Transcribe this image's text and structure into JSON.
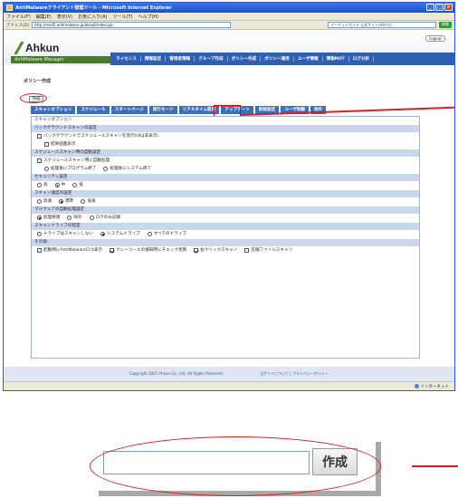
{
  "window": {
    "title": "AntiMalwareクライアント管理ツール - Microsoft Internet Explorer",
    "controls": [
      "_",
      "□",
      "×"
    ]
  },
  "menu": [
    "ファイル(F)",
    "編集(E)",
    "表示(V)",
    "お気に入り(A)",
    "ツール(T)",
    "ヘルプ(H)"
  ],
  "address": {
    "label": "アドレス(D)",
    "url": "http://mail5.antimalware.jp/aksx6/index.jsp",
    "search_text": "マーケットガイド 公式サイト(Alt+n)",
    "go_label": "移動"
  },
  "header": {
    "logout": "Logout",
    "logo_text": "Ahkun",
    "logo_sub": "AntiMalware Manager",
    "nav": [
      "ライセンス",
      "情報設定",
      "管理者情報",
      "グループ作成",
      "ポリシー作成",
      "ポリシー適用",
      "ユーザ情報",
      "情報NOT",
      "ログ分析"
    ]
  },
  "page": {
    "title": "ポリシー作成",
    "create_button": "作成"
  },
  "tabs": [
    "スキャンオプション",
    "スケジュール",
    "スタートページ",
    "実行モード",
    "リアルタイム監視",
    "アップデート",
    "削除設定",
    "ユーザ制御",
    "除外"
  ],
  "options": {
    "subtitle": "スキャンオプション",
    "sections": [
      {
        "header": "バックグラウンドスキャンの設定",
        "rows": [
          {
            "type": "checkbox",
            "checked": false,
            "label": "バックグラウンドでスケジュールスキャンを実行(UIは非表示)"
          },
          {
            "type": "checkbox",
            "checked": false,
            "label": "結果画面表示",
            "indent": true
          }
        ]
      },
      {
        "header": "スケジュールスキャン時の自動設定",
        "rows": [
          {
            "type": "checkbox",
            "checked": false,
            "label": "スケジュールスキャン時に自動処理"
          },
          {
            "type": "radios",
            "indent": true,
            "options": [
              {
                "label": "処理後にプログラム終了",
                "on": false
              },
              {
                "label": "処理後にシステム終了",
                "on": false
              }
            ]
          }
        ]
      },
      {
        "header": "セキュリティ設定",
        "rows": [
          {
            "type": "radios",
            "options": [
              {
                "label": "高",
                "on": false
              },
              {
                "label": "中",
                "on": true
              },
              {
                "label": "低",
                "on": false
              }
            ]
          }
        ]
      },
      {
        "header": "スキャン速度の設定",
        "rows": [
          {
            "type": "radios",
            "options": [
              {
                "label": "高速",
                "on": false
              },
              {
                "label": "標準",
                "on": true
              },
              {
                "label": "低速",
                "on": false
              }
            ]
          }
        ]
      },
      {
        "header": "マルウェアの自動処理設定",
        "rows": [
          {
            "type": "radios",
            "options": [
              {
                "label": "処理要請",
                "on": true
              },
              {
                "label": "除外",
                "on": false
              },
              {
                "label": "ログのみ記録",
                "on": false
              }
            ]
          }
        ]
      },
      {
        "header": "スキャンドライブの指定",
        "rows": [
          {
            "type": "radios",
            "options": [
              {
                "label": "ドライブはスキャンしない",
                "on": false
              },
              {
                "label": "システムドライブ",
                "on": true
              },
              {
                "label": "すべてのドライブ",
                "on": false
              }
            ]
          }
        ]
      },
      {
        "header": "その他",
        "rows": [
          {
            "type": "checks",
            "options": [
              {
                "label": "起動時にAntiMalwareロゴ表示",
                "on": false
              },
              {
                "label": "クレーツールの検知時にチェック状態",
                "on": true
              },
              {
                "label": "右クリックスキャン",
                "on": true
              },
              {
                "label": "圧縮ファイルスキャン",
                "on": false
              }
            ]
          }
        ]
      }
    ]
  },
  "footer": {
    "copyright": "Copyright 2007 Ahkun Co., Ltd. All Rights Reserved",
    "links": "当サイトについて | プライバシーポリシー"
  },
  "statusbar": {
    "zone": "インターネット"
  },
  "zoom": {
    "button_label": "作成"
  }
}
